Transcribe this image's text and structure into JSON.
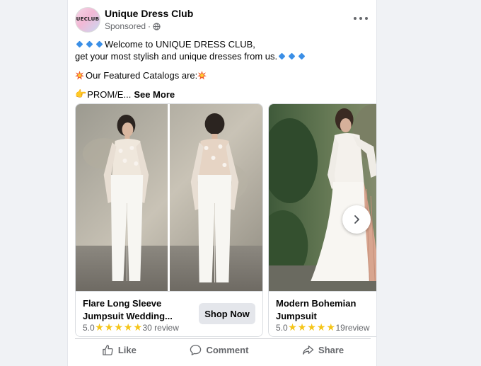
{
  "post": {
    "page_name": "Unique Dress Club",
    "avatar_text": "UECLUB",
    "sponsored": "Sponsored",
    "sponsored_sep": "·",
    "more_icon": "more-horizontal-icon"
  },
  "body": {
    "line1": "Welcome to UNIQUE DRESS CLUB,",
    "line2": "get your most stylish and unique dresses from us.",
    "line3": "Our Featured Catalogs are:",
    "line4": "PROM/E...",
    "see_more": "See More"
  },
  "cards": [
    {
      "title_line1": "Flare Long Sleeve",
      "title_line2": "Jumpsuit Wedding...",
      "rating": "5.0",
      "stars": 5,
      "reviews": "30 review",
      "cta": "Shop Now"
    },
    {
      "title_line1": "Modern Bohemian",
      "title_line2": "Jumpsuit",
      "rating": "5.0",
      "stars": 5,
      "reviews": "19review"
    }
  ],
  "actions": {
    "like": "Like",
    "comment": "Comment",
    "share": "Share"
  },
  "colors": {
    "secondary_text": "#65676b",
    "button_bg": "#e4e6eb",
    "star": "#f5c518",
    "diamond": "#3b8fe6"
  }
}
